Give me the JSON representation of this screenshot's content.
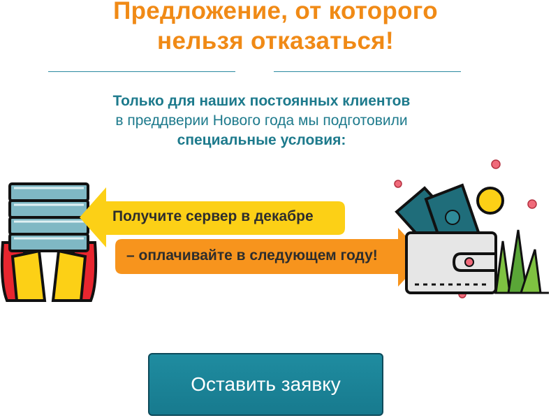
{
  "offer": {
    "title_line1": "Предложение, от которого",
    "title_line2": "нельзя отказаться!",
    "subtitle_line1": "Только для наших постоянных клиентов",
    "subtitle_line2": "в преддверии Нового года мы подготовили",
    "subtitle_line3": "специальные условия:"
  },
  "arrows": {
    "left_label": "Получите сервер в декабре",
    "right_label": "– оплачивайте в следующем году!"
  },
  "cta": {
    "label": "Оставить заявку"
  },
  "colors": {
    "title": "#f08a16",
    "accent_teal": "#1d7a8c",
    "yellow_arrow": "#fcd016",
    "orange_arrow": "#f7941d",
    "button": "#1a8397"
  },
  "icons": {
    "left": "server-stack-hands-icon",
    "right": "wallet-money-icon"
  }
}
